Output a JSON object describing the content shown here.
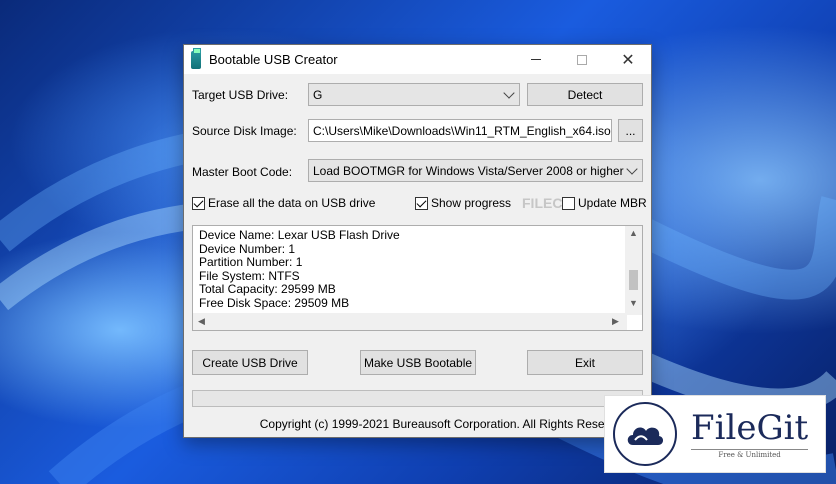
{
  "window": {
    "title": "Bootable USB Creator"
  },
  "target": {
    "label": "Target USB Drive:",
    "value": "G",
    "detect_label": "Detect"
  },
  "source": {
    "label": "Source Disk Image:",
    "value": "C:\\Users\\Mike\\Downloads\\Win11_RTM_English_x64.iso",
    "browse_label": "..."
  },
  "boot": {
    "label": "Master Boot Code:",
    "value": "Load BOOTMGR for Windows Vista/Server 2008 or higher"
  },
  "options": {
    "erase": {
      "label": "Erase all the data on USB drive",
      "checked": true
    },
    "progress": {
      "label": "Show progress",
      "checked": true
    },
    "mbr": {
      "label": "Update MBR",
      "checked": false
    }
  },
  "info": {
    "lines": [
      "Device Name: Lexar USB Flash Drive",
      "Device Number: 1",
      "Partition Number: 1",
      "File System: NTFS",
      "Total Capacity: 29599 MB",
      "Free Disk Space: 29509 MB"
    ]
  },
  "actions": {
    "create": "Create USB Drive",
    "bootable": "Make USB Bootable",
    "exit": "Exit"
  },
  "progress": {
    "value": 0
  },
  "footer": {
    "copyright": "Copyright (c) 1999-2021 Bureausoft Corporation. All Rights Reserved."
  },
  "watermark": {
    "text": "FILECR"
  },
  "badge": {
    "name": "FileGit",
    "tagline": "Free & Unlimited"
  },
  "icons": [
    "usb-app-icon",
    "minimize-icon",
    "maximize-icon",
    "close-icon",
    "chevron-down-icon",
    "scroll-up-icon",
    "scroll-down-icon",
    "scroll-left-icon",
    "scroll-right-icon",
    "cloud-logo-icon"
  ]
}
